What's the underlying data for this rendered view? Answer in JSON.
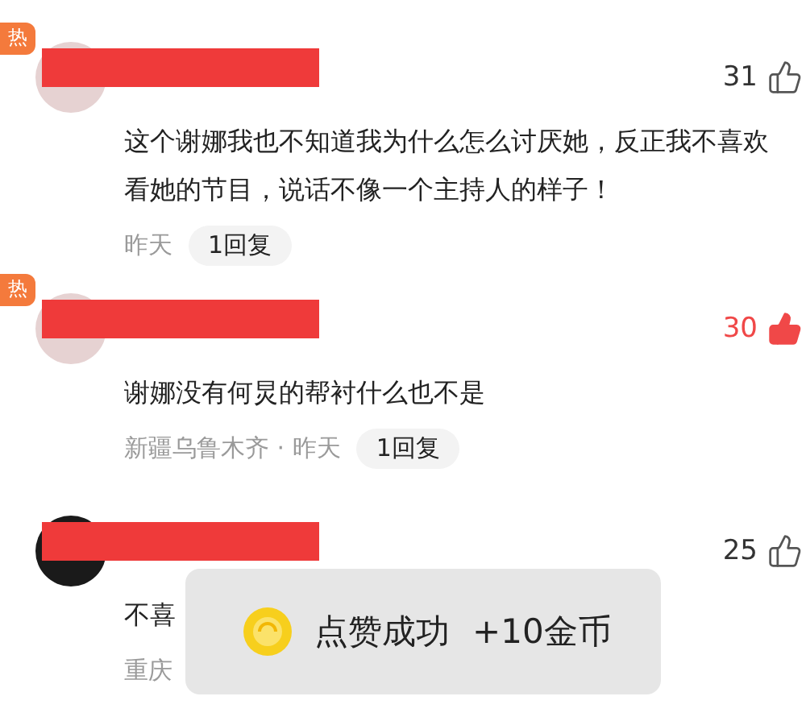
{
  "comments": [
    {
      "hot": true,
      "hot_label": "热",
      "likes": "31",
      "liked": false,
      "body": [
        "这个谢娜我也不知道我为什么怎么讨厌她，反正我不喜欢",
        "看她的节目，说话不像一个主持人的样子！"
      ],
      "time": "昨天",
      "replies": "1回复"
    },
    {
      "hot": true,
      "hot_label": "热",
      "likes": "30",
      "liked": true,
      "body": [
        "谢娜没有何炅的帮衬什么也不是"
      ],
      "location": "新疆乌鲁木齐",
      "separator": "·",
      "time": "昨天",
      "replies": "1回复"
    },
    {
      "hot": false,
      "likes": "25",
      "liked": false,
      "body": [
        "不喜"
      ],
      "location": "重庆"
    }
  ],
  "toast": {
    "message": "点赞成功",
    "reward": "+10金币"
  }
}
